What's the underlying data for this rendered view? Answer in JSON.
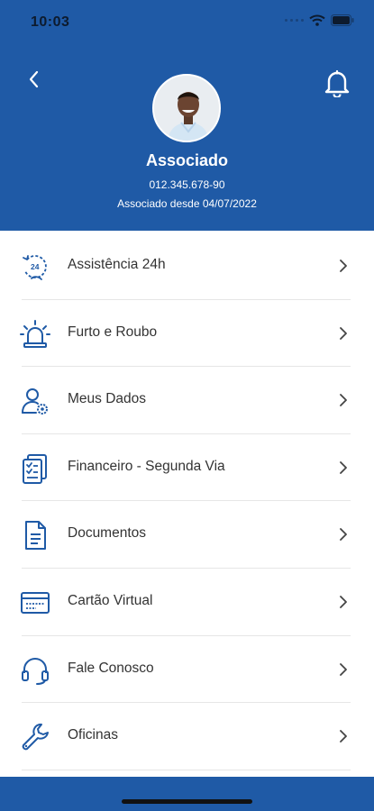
{
  "status_bar": {
    "time": "10:03"
  },
  "profile": {
    "name": "Associado",
    "cpf": "012.345.678-90",
    "member_since": "Associado desde 04/07/2022"
  },
  "menu": [
    {
      "label": "Assistência 24h",
      "icon": "assistance-24h-icon"
    },
    {
      "label": "Furto e Roubo",
      "icon": "siren-icon"
    },
    {
      "label": "Meus Dados",
      "icon": "user-settings-icon"
    },
    {
      "label": "Financeiro - Segunda Via",
      "icon": "document-checklist-icon"
    },
    {
      "label": "Documentos",
      "icon": "document-icon"
    },
    {
      "label": "Cartão Virtual",
      "icon": "card-icon"
    },
    {
      "label": "Fale Conosco",
      "icon": "headset-icon"
    },
    {
      "label": "Oficinas",
      "icon": "wrench-icon"
    }
  ],
  "colors": {
    "primary": "#1f5aa6",
    "icon": "#1f5aa6",
    "text": "#333333"
  }
}
